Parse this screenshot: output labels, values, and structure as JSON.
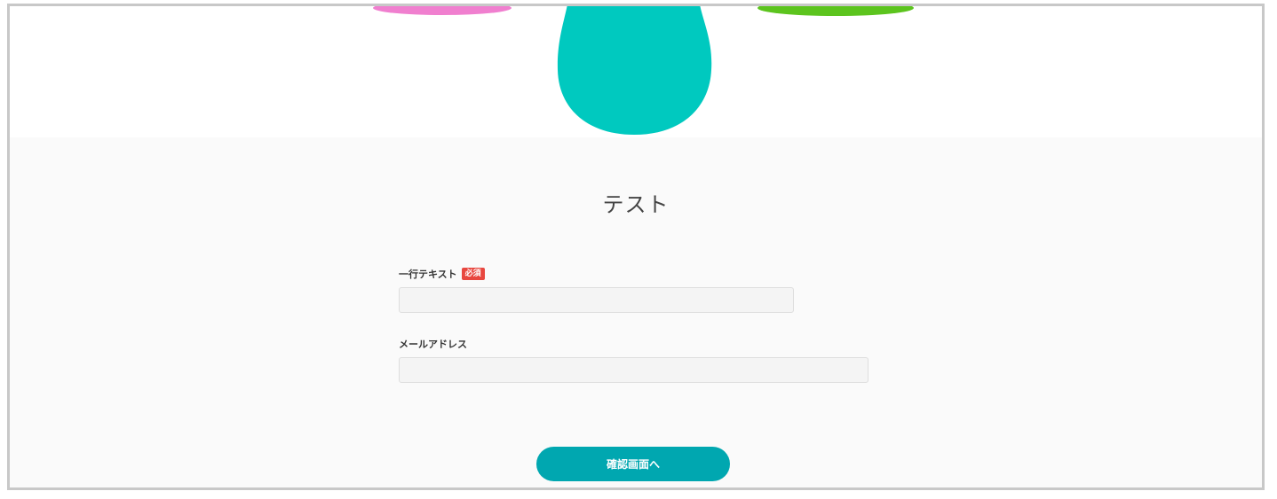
{
  "form": {
    "title": "テスト",
    "fields": [
      {
        "label": "一行テキスト",
        "required_badge": "必須",
        "value": "",
        "placeholder": ""
      },
      {
        "label": "メールアドレス",
        "value": "",
        "placeholder": ""
      }
    ],
    "submit_label": "確認画面へ"
  },
  "colors": {
    "accent": "#00a7b0",
    "required_badge": "#e8473f",
    "drop_teal": "#00c9bf",
    "drop_pink": "#f07fcf",
    "drop_green": "#5cc41e"
  }
}
